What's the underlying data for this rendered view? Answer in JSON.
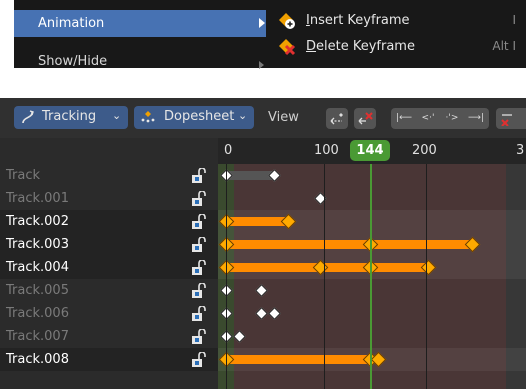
{
  "menu": {
    "animation_label": "Animation",
    "showhide_label": "Show/Hide",
    "submenu": [
      {
        "label": "Insert Keyframe",
        "mnemonic": "I",
        "rest": "nsert Keyframe",
        "shortcut": "I",
        "icon": "keyframe-insert-icon"
      },
      {
        "label": "Delete Keyframe",
        "mnemonic": "D",
        "rest": "elete Keyframe",
        "shortcut": "Alt I",
        "icon": "keyframe-delete-icon"
      }
    ]
  },
  "header": {
    "mode_label": "Tracking",
    "editor_label": "Dopesheet",
    "view_label": "View",
    "mode_icon": "tracking-icon",
    "editor_icon": "dopesheet-icon"
  },
  "ruler": {
    "ticks": [
      "0",
      "100",
      "200",
      "3"
    ],
    "current_frame": "144"
  },
  "channels": [
    {
      "name": "Track",
      "selected": false,
      "keys": [
        0,
        48
      ],
      "bar": [
        0,
        48
      ],
      "bar_active": false
    },
    {
      "name": "Track.001",
      "selected": false,
      "keys": [
        94
      ],
      "bar": null,
      "bar_active": false
    },
    {
      "name": "Track.002",
      "selected": true,
      "keys": [
        0,
        62
      ],
      "bar": [
        0,
        62
      ],
      "bar_active": true
    },
    {
      "name": "Track.003",
      "selected": true,
      "keys": [
        0,
        144,
        246
      ],
      "bar": [
        0,
        246
      ],
      "bar_active": true
    },
    {
      "name": "Track.004",
      "selected": true,
      "keys": [
        0,
        94,
        144,
        202
      ],
      "bar": [
        0,
        202
      ],
      "bar_active": true
    },
    {
      "name": "Track.005",
      "selected": false,
      "keys": [
        0,
        35
      ],
      "bar": null,
      "bar_active": false
    },
    {
      "name": "Track.006",
      "selected": false,
      "keys": [
        0,
        35,
        48
      ],
      "bar": null,
      "bar_active": false
    },
    {
      "name": "Track.007",
      "selected": false,
      "keys": [
        0,
        13
      ],
      "bar": null,
      "bar_active": false
    },
    {
      "name": "Track.008",
      "selected": true,
      "keys": [
        0,
        144,
        152
      ],
      "bar": [
        0,
        144
      ],
      "bar_active": true
    }
  ],
  "colors": {
    "accent": "#4772b3",
    "playhead": "#4a9a34",
    "keyframe_selected": "#ffaa00",
    "bar_active": "#ff8c00"
  }
}
